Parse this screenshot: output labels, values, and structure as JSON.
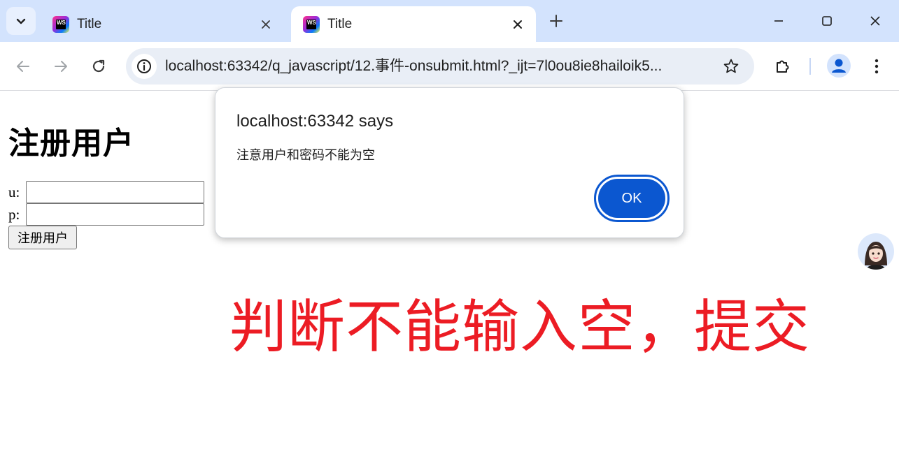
{
  "tabs": [
    {
      "title": "Title",
      "active": false
    },
    {
      "title": "Title",
      "active": true
    }
  ],
  "toolbar": {
    "url": "localhost:63342/q_javascript/12.事件-onsubmit.html?_ijt=7l0ou8ie8hailoik5..."
  },
  "page": {
    "heading": "注册用户",
    "username_label": "u:",
    "password_label": "p:",
    "username_value": "",
    "password_value": "",
    "submit_label": "注册用户",
    "annotation": "判断不能输入空，提交"
  },
  "dialog": {
    "title": "localhost:63342 says",
    "message": "注意用户和密码不能为空",
    "ok_label": "OK"
  },
  "colors": {
    "tabstrip": "#d3e3fd",
    "accent": "#0b57d0",
    "annotation": "#ec1c24"
  }
}
